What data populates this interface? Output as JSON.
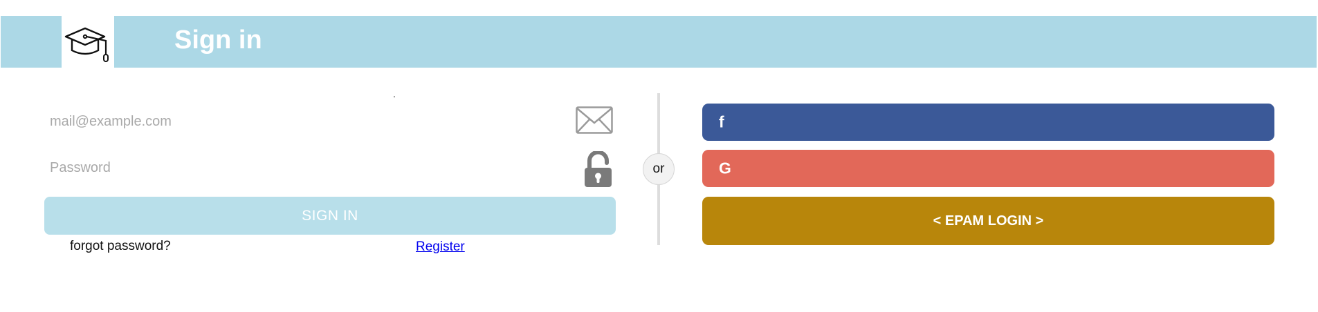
{
  "header": {
    "title": "Sign in",
    "logo_icon": "graduation-cap-icon"
  },
  "form": {
    "marker": ".",
    "email_placeholder": "mail@example.com",
    "password_placeholder": "Password",
    "email_icon": "envelope-icon",
    "password_icon": "unlocked-padlock-icon",
    "signin_label": "SIGN IN",
    "forgot_label": "forgot password?",
    "register_label": "Register"
  },
  "separator": {
    "label": "or"
  },
  "social": {
    "facebook_glyph": "f",
    "google_glyph": "G",
    "epam_label": "< EPAM LOGIN >"
  },
  "colors": {
    "header_bg": "#acd8e6",
    "signin_bg": "#b8dfea",
    "facebook": "#3b5998",
    "google": "#e26859",
    "epam": "#b8860b"
  }
}
